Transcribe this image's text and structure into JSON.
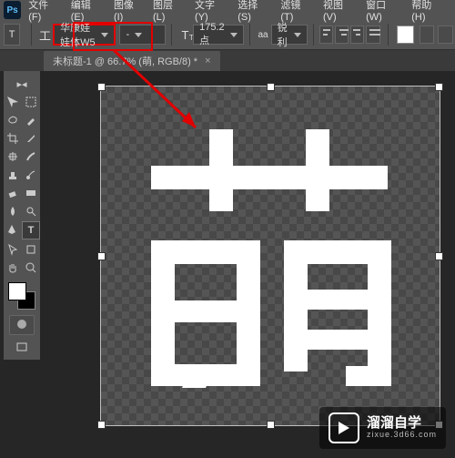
{
  "menu": {
    "file": "文件(F)",
    "edit": "编辑(E)",
    "image": "图像(I)",
    "layer": "图层(L)",
    "type": "文字(Y)",
    "select": "选择(S)",
    "filter": "滤镜(T)",
    "view": "视图(V)",
    "window": "窗口(W)",
    "help": "帮助(H)"
  },
  "options": {
    "tool_glyph": "T",
    "orient_glyph": "工",
    "font_family": "华康娃娃体W5",
    "font_style": "-",
    "size_glyph": "T",
    "size_sub": "T",
    "font_size": "175.2 点",
    "aa_label": "aa",
    "aa_mode": "锐利"
  },
  "tab": {
    "title": "未标题-1 @ 66.7% (萌, RGB/8) *",
    "close": "×"
  },
  "canvas": {
    "character": "萌"
  },
  "fgbg": {
    "fg": "#ffffff",
    "bg": "#000000"
  },
  "watermark": {
    "cn": "溜溜自学",
    "en": "zixue.3d66.com"
  }
}
